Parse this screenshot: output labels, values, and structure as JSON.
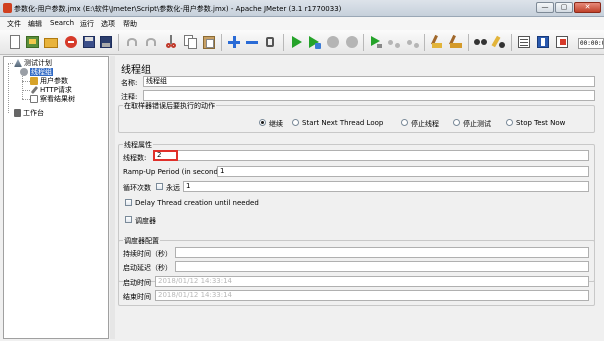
{
  "window": {
    "title": "参数化-用户参数.jmx (E:\\软件\\Jmeter\\Script\\参数化-用户参数.jmx) - Apache JMeter (3.1 r1770033)",
    "min_label": "—",
    "max_label": "▢",
    "close_label": "✕"
  },
  "menu": [
    "文件",
    "编辑",
    "Search",
    "运行",
    "选项",
    "帮助"
  ],
  "toolbar": {
    "icons": [
      "new-icon",
      "templates-icon",
      "open-icon",
      "close-icon",
      "save-icon",
      "save-as-icon",
      "cut-icon",
      "copy-icon",
      "paste-icon",
      "expand-icon",
      "collapse-icon",
      "toggle-icon",
      "start-icon",
      "start-no-pause-icon",
      "stop-icon",
      "shutdown-icon",
      "remote-start-icon",
      "remote-stop-icon",
      "remote-shutdown-icon",
      "clear-icon",
      "clear-all-icon",
      "search-icon",
      "reset-search-icon",
      "function-helper-icon",
      "help-icon",
      "log-viewer-icon"
    ],
    "counter": "00:00:00"
  },
  "tree": {
    "test_plan": "测试计划",
    "thread_group": "线程组",
    "user_params": "用户参数",
    "http_request": "HTTP请求",
    "result_tree": "察看结果树",
    "workbench": "工作台"
  },
  "panel": {
    "title": "线程组",
    "name_label": "名称:",
    "name_value": "线程组",
    "comment_label": "注释:",
    "comment_value": "",
    "on_error": {
      "title": "在取样器错误后要执行的动作",
      "options": [
        "继续",
        "Start Next Thread Loop",
        "停止线程",
        "停止测试",
        "Stop Test Now"
      ],
      "selected": "继续"
    },
    "thread_props": {
      "title": "线程属性",
      "threads_label": "线程数:",
      "threads_value": "2",
      "rampup_label": "Ramp-Up Period (in seconds):",
      "rampup_value": "1",
      "loop_label": "循环次数",
      "forever_label": "永远",
      "loop_value": "1",
      "delay_label": "Delay Thread creation until needed",
      "scheduler_label": "调度器"
    },
    "scheduler": {
      "title": "调度器配置",
      "duration_label": "持续时间（秒）",
      "duration_value": "",
      "delay_label": "启动延迟（秒）",
      "delay_value": "",
      "start_label": "启动时间",
      "start_value": "2018/01/12 14:33:14",
      "end_label": "结束时间",
      "end_value": "2018/01/12 14:33:14"
    }
  },
  "colors": {
    "selection": "#316ac5",
    "highlight_border": "#e0302a"
  }
}
